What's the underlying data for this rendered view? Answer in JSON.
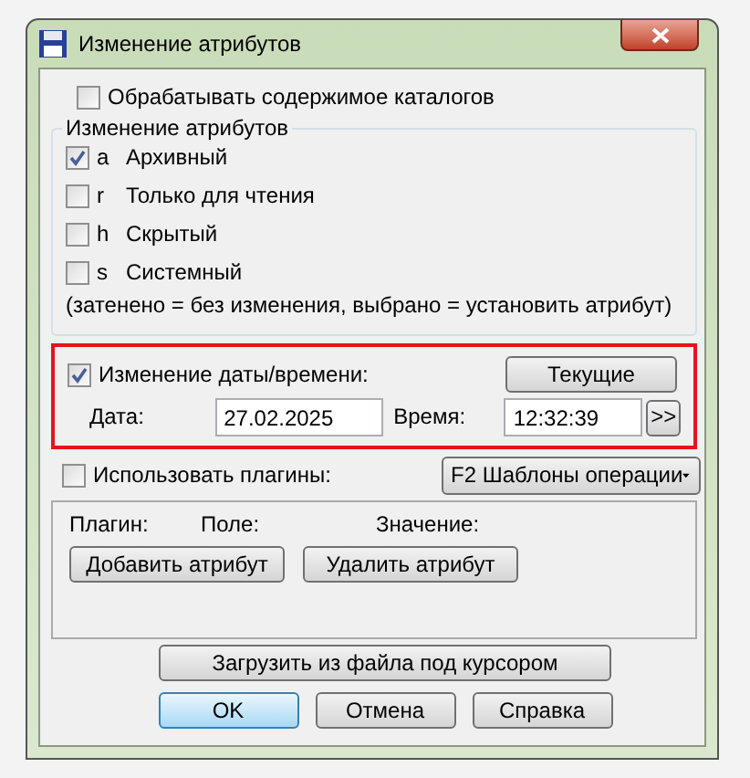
{
  "window": {
    "title": "Изменение атрибутов"
  },
  "recurse": {
    "label": "Обрабатывать содержимое каталогов",
    "checked": false
  },
  "attributes": {
    "title": "Изменение атрибутов",
    "items": [
      {
        "letter": "a",
        "label": "Архивный",
        "checked": true
      },
      {
        "letter": "r",
        "label": "Только для чтения",
        "checked": false
      },
      {
        "letter": "h",
        "label": "Скрытый",
        "checked": false
      },
      {
        "letter": "s",
        "label": "Системный",
        "checked": false
      }
    ],
    "note": "(затенено = без изменения, выбрано = установить атрибут)"
  },
  "datetime": {
    "label": "Изменение даты/времени:",
    "checked": true,
    "now_button": "Текущие",
    "date_label": "Дата:",
    "date": "27.02.2025",
    "time_label": "Время:",
    "time": "12:32:39",
    "more_button": ">>"
  },
  "plugins": {
    "label": "Использовать плагины:",
    "checked": false,
    "dropdown": "F2 Шаблоны операции",
    "columns": [
      "Плагин:",
      "Поле:",
      "Значение:"
    ],
    "buttons": [
      "Добавить атрибут",
      "Удалить атрибут"
    ]
  },
  "load_button": "Загрузить из файла под курсором",
  "buttons": [
    {
      "label": "OK",
      "default": true
    },
    {
      "label": "Отмена",
      "default": false
    },
    {
      "label": "Справка",
      "default": false
    }
  ]
}
